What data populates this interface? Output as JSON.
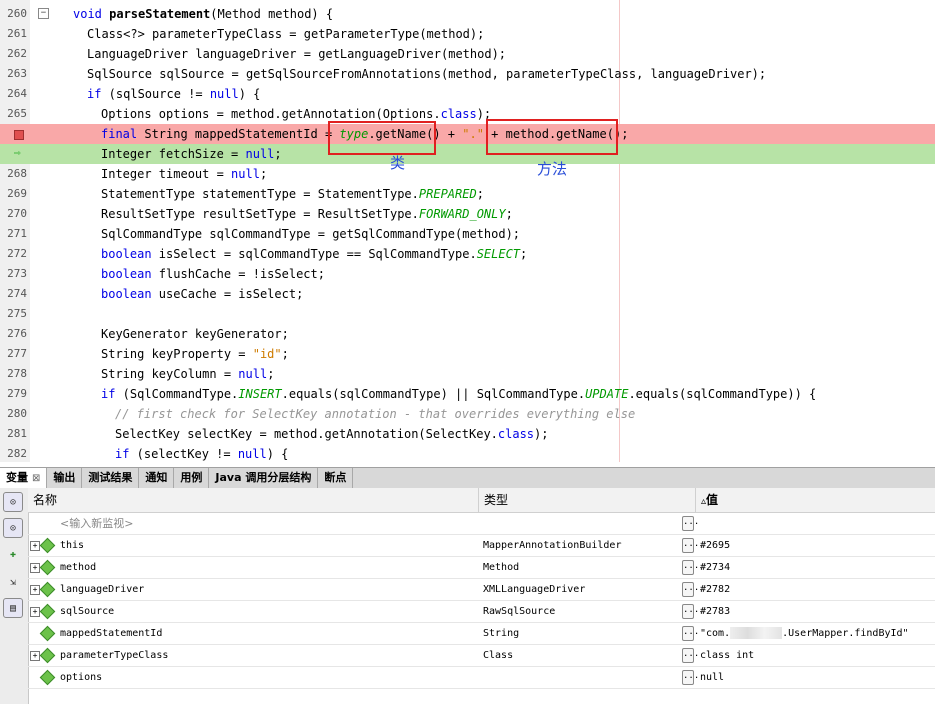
{
  "editor": {
    "lines": [
      {
        "num": "260",
        "kind": "normal",
        "indent": 1,
        "parts": [
          [
            "kw",
            "void "
          ],
          [
            "fn",
            "parseStatement"
          ],
          [
            "",
            "(Method method) {"
          ]
        ]
      },
      {
        "num": "261",
        "kind": "normal",
        "indent": 2,
        "parts": [
          [
            "",
            "Class<?> parameterTypeClass = getParameterType(method);"
          ]
        ]
      },
      {
        "num": "262",
        "kind": "normal",
        "indent": 2,
        "parts": [
          [
            "",
            "LanguageDriver languageDriver = getLanguageDriver(method);"
          ]
        ]
      },
      {
        "num": "263",
        "kind": "normal",
        "indent": 2,
        "parts": [
          [
            "",
            "SqlSource sqlSource = getSqlSourceFromAnnotations(method, parameterTypeClass, languageDriver);"
          ]
        ]
      },
      {
        "num": "264",
        "kind": "normal",
        "indent": 2,
        "parts": [
          [
            "kw",
            "if"
          ],
          [
            "",
            " (sqlSource != "
          ],
          [
            "kw",
            "null"
          ],
          [
            "",
            ") {"
          ]
        ]
      },
      {
        "num": "265",
        "kind": "normal",
        "indent": 3,
        "parts": [
          [
            "",
            "Options options = method.getAnnotation(Options."
          ],
          [
            "kw",
            "class"
          ],
          [
            "",
            ");"
          ]
        ]
      },
      {
        "num": "",
        "kind": "breakpoint",
        "indent": 3,
        "parts": [
          [
            "kw",
            "final"
          ],
          [
            "",
            " String mappedStatementId = "
          ],
          [
            "cst",
            "type"
          ],
          [
            "",
            ".getName() + "
          ],
          [
            "str",
            "\".\""
          ],
          [
            "",
            " + method.getName();"
          ]
        ]
      },
      {
        "num": "",
        "kind": "current",
        "indent": 3,
        "parts": [
          [
            "",
            "Integer fetchSize = "
          ],
          [
            "kw",
            "null"
          ],
          [
            "",
            ";"
          ]
        ]
      },
      {
        "num": "268",
        "kind": "normal",
        "indent": 3,
        "parts": [
          [
            "",
            "Integer timeout = "
          ],
          [
            "kw",
            "null"
          ],
          [
            "",
            ";"
          ]
        ]
      },
      {
        "num": "269",
        "kind": "normal",
        "indent": 3,
        "parts": [
          [
            "",
            "StatementType statementType = StatementType."
          ],
          [
            "cst",
            "PREPARED"
          ],
          [
            "",
            ";"
          ]
        ]
      },
      {
        "num": "270",
        "kind": "normal",
        "indent": 3,
        "parts": [
          [
            "",
            "ResultSetType resultSetType = ResultSetType."
          ],
          [
            "cst",
            "FORWARD_ONLY"
          ],
          [
            "",
            ";"
          ]
        ]
      },
      {
        "num": "271",
        "kind": "normal",
        "indent": 3,
        "parts": [
          [
            "",
            "SqlCommandType sqlCommandType = getSqlCommandType(method);"
          ]
        ]
      },
      {
        "num": "272",
        "kind": "normal",
        "indent": 3,
        "parts": [
          [
            "kw",
            "boolean"
          ],
          [
            "",
            " isSelect = sqlCommandType == SqlCommandType."
          ],
          [
            "cst",
            "SELECT"
          ],
          [
            "",
            ";"
          ]
        ]
      },
      {
        "num": "273",
        "kind": "normal",
        "indent": 3,
        "parts": [
          [
            "kw",
            "boolean"
          ],
          [
            "",
            " flushCache = !isSelect;"
          ]
        ]
      },
      {
        "num": "274",
        "kind": "normal",
        "indent": 3,
        "parts": [
          [
            "kw",
            "boolean"
          ],
          [
            "",
            " useCache = isSelect;"
          ]
        ]
      },
      {
        "num": "275",
        "kind": "normal",
        "indent": 3,
        "parts": []
      },
      {
        "num": "276",
        "kind": "normal",
        "indent": 3,
        "parts": [
          [
            "",
            "KeyGenerator keyGenerator;"
          ]
        ]
      },
      {
        "num": "277",
        "kind": "normal",
        "indent": 3,
        "parts": [
          [
            "",
            "String keyProperty = "
          ],
          [
            "str",
            "\"id\""
          ],
          [
            "",
            ";"
          ]
        ]
      },
      {
        "num": "278",
        "kind": "normal",
        "indent": 3,
        "parts": [
          [
            "",
            "String keyColumn = "
          ],
          [
            "kw",
            "null"
          ],
          [
            "",
            ";"
          ]
        ]
      },
      {
        "num": "279",
        "kind": "normal",
        "indent": 3,
        "parts": [
          [
            "kw",
            "if"
          ],
          [
            "",
            " (SqlCommandType."
          ],
          [
            "cst",
            "INSERT"
          ],
          [
            "",
            ".equals(sqlCommandType) || SqlCommandType."
          ],
          [
            "cst",
            "UPDATE"
          ],
          [
            "",
            ".equals(sqlCommandType)) {"
          ]
        ]
      },
      {
        "num": "280",
        "kind": "normal",
        "indent": 4,
        "parts": [
          [
            "cmt",
            "// first check for SelectKey annotation - that overrides everything else"
          ]
        ]
      },
      {
        "num": "281",
        "kind": "normal",
        "indent": 4,
        "parts": [
          [
            "",
            "SelectKey selectKey = method.getAnnotation(SelectKey."
          ],
          [
            "kw",
            "class"
          ],
          [
            "",
            ");"
          ]
        ]
      },
      {
        "num": "282",
        "kind": "normal",
        "indent": 4,
        "parts": [
          [
            "kw",
            "if"
          ],
          [
            "",
            " (selectKey != "
          ],
          [
            "kw",
            "null"
          ],
          [
            "",
            ") {"
          ]
        ]
      }
    ],
    "annotations": {
      "class_label": "类",
      "method_label": "方法"
    }
  },
  "tabs": [
    {
      "label": "变量",
      "active": true,
      "closable": true
    },
    {
      "label": "输出"
    },
    {
      "label": "测试结果"
    },
    {
      "label": "通知"
    },
    {
      "label": "用例"
    },
    {
      "label": "Java 调用分层结构"
    },
    {
      "label": "断点"
    }
  ],
  "variables": {
    "header": {
      "name": "名称",
      "type": "类型",
      "value": "值",
      "sort_indicator": "▵"
    },
    "watch_hint": "<输入新监视>",
    "rows": [
      {
        "name": "this",
        "type": "MapperAnnotationBuilder",
        "value": "#2695",
        "expandable": true
      },
      {
        "name": "method",
        "type": "Method",
        "value": "#2734",
        "expandable": true
      },
      {
        "name": "languageDriver",
        "type": "XMLLanguageDriver",
        "value": "#2782",
        "expandable": true
      },
      {
        "name": "sqlSource",
        "type": "RawSqlSource",
        "value": "#2783",
        "expandable": true
      },
      {
        "name": "mappedStatementId",
        "type": "String",
        "value_prefix": "\"com.",
        "value_suffix": ".UserMapper.findById\"",
        "redacted": true,
        "expandable": false
      },
      {
        "name": "parameterTypeClass",
        "type": "Class",
        "value": "class int",
        "expandable": true
      },
      {
        "name": "options",
        "type": "",
        "value": "null",
        "expandable": false
      }
    ],
    "dots_label": "..."
  },
  "toolbar_icons": [
    "watch-icon",
    "watch-add-icon",
    "new-watch-icon",
    "step-icon",
    "show-values-icon"
  ]
}
